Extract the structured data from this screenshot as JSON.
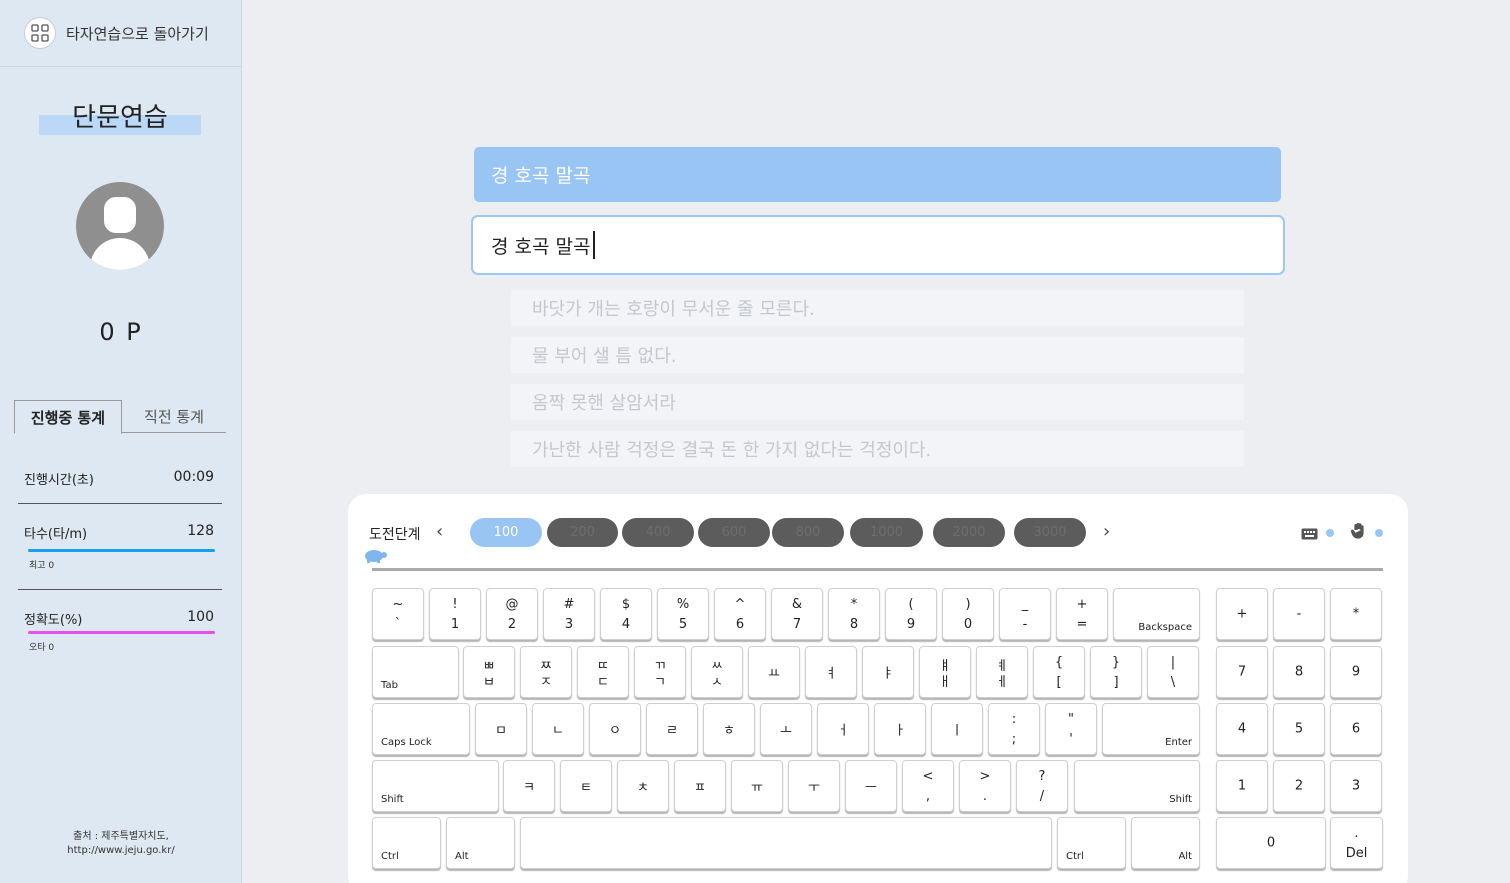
{
  "sidebar": {
    "back_label": "타자연습으로 돌아가기",
    "title": "단문연습",
    "points": "0 P",
    "tabs": [
      "진행중 통계",
      "직전 통계"
    ],
    "stats": {
      "time_label": "진행시간(초)",
      "time_value": "00:09",
      "speed_label": "타수(타/m)",
      "speed_value": "128",
      "speed_best": "최고 0",
      "accuracy_label": "정확도(%)",
      "accuracy_value": "100",
      "typo_label": "오타 0"
    },
    "source_line1": "출처 : 제주특별자치도,",
    "source_line2": "http://www.jeju.go.kr/",
    "colors": {
      "speed_bar": "#1a9ef0",
      "accuracy_bar": "#e84fe8"
    }
  },
  "practice": {
    "prompt": "경 호곡 말곡",
    "typed": "경 호곡 말곡",
    "upcoming": [
      "바닷가 개는 호랑이 무서운 줄 모른다.",
      "물 부어 샐 틈 없다.",
      "옴짝 못핸 살암서라",
      "가난한 사람 걱정은 결국 돈 한 가지 없다는 걱정이다."
    ]
  },
  "keyboard": {
    "level_label": "도전단계",
    "levels": [
      "100",
      "200",
      "400",
      "600",
      "800",
      "1000",
      "2000",
      "3000"
    ],
    "active_level": "100",
    "row1": [
      [
        "~",
        "`"
      ],
      [
        "!",
        "1"
      ],
      [
        "@",
        "2"
      ],
      [
        "#",
        "3"
      ],
      [
        "$",
        "4"
      ],
      [
        "%",
        "5"
      ],
      [
        "^",
        "6"
      ],
      [
        "&",
        "7"
      ],
      [
        "*",
        "8"
      ],
      [
        "(",
        "9"
      ],
      [
        ")",
        "0"
      ],
      [
        "_",
        "-"
      ],
      [
        "+",
        "="
      ]
    ],
    "backspace": "Backspace",
    "tab": "Tab",
    "row2": [
      [
        "ㅃ",
        "ㅂ"
      ],
      [
        "ㅉ",
        "ㅈ"
      ],
      [
        "ㄸ",
        "ㄷ"
      ],
      [
        "ㄲ",
        "ㄱ"
      ],
      [
        "ㅆ",
        "ㅅ"
      ],
      [
        "",
        "ㅛ"
      ],
      [
        "",
        "ㅕ"
      ],
      [
        "",
        "ㅑ"
      ],
      [
        "ㅒ",
        "ㅐ"
      ],
      [
        "ㅖ",
        "ㅔ"
      ],
      [
        "{",
        "["
      ],
      [
        "}",
        "]"
      ],
      [
        "|",
        "\\"
      ]
    ],
    "capslock": "Caps Lock",
    "row3": [
      [
        "",
        "ㅁ"
      ],
      [
        "",
        "ㄴ"
      ],
      [
        "",
        "ㅇ"
      ],
      [
        "",
        "ㄹ"
      ],
      [
        "",
        "ㅎ"
      ],
      [
        "",
        "ㅗ"
      ],
      [
        "",
        "ㅓ"
      ],
      [
        "",
        "ㅏ"
      ],
      [
        "",
        "ㅣ"
      ],
      [
        ":",
        ";"
      ],
      [
        "\"",
        "'"
      ]
    ],
    "enter": "Enter",
    "shift": "Shift",
    "row4": [
      [
        "",
        "ㅋ"
      ],
      [
        "",
        "ㅌ"
      ],
      [
        "",
        "ㅊ"
      ],
      [
        "",
        "ㅍ"
      ],
      [
        "",
        "ㅠ"
      ],
      [
        "",
        "ㅜ"
      ],
      [
        "",
        "ㅡ"
      ],
      [
        "<",
        ","
      ],
      [
        ">",
        "."
      ],
      [
        "?",
        "/"
      ]
    ],
    "ctrl": "Ctrl",
    "alt": "Alt",
    "numpad": [
      "+",
      "-",
      "*",
      "7",
      "8",
      "9",
      "4",
      "5",
      "6",
      "1",
      "2",
      "3",
      "0",
      "."
    ],
    "del": "Del"
  }
}
